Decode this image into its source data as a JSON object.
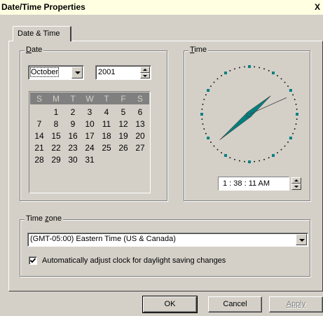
{
  "window": {
    "title": "Date/Time Properties",
    "close_glyph": "X"
  },
  "tabs": [
    {
      "label": "Date & Time"
    }
  ],
  "date_group": {
    "label_hotkey": "D",
    "label_rest": "ate",
    "month": "October",
    "year": "2001",
    "weekdays": [
      "S",
      "M",
      "T",
      "W",
      "T",
      "F",
      "S"
    ],
    "weeks": [
      [
        "",
        "1",
        "2",
        "3",
        "4",
        "5",
        "6"
      ],
      [
        "7",
        "8",
        "9",
        "10",
        "11",
        "12",
        "13"
      ],
      [
        "14",
        "15",
        "16",
        "17",
        "18",
        "19",
        "20"
      ],
      [
        "21",
        "22",
        "23",
        "24",
        "25",
        "26",
        "27"
      ],
      [
        "28",
        "29",
        "30",
        "31",
        "",
        "",
        ""
      ]
    ]
  },
  "time_group": {
    "label_hotkey": "T",
    "label_rest": "ime",
    "time_value": "1 : 38 : 11 AM",
    "clock": {
      "hour": 1,
      "minute": 38,
      "second": 11,
      "accent": "#008080"
    }
  },
  "timezone_group": {
    "label_prefix": "Time ",
    "label_hotkey": "z",
    "label_rest": "one",
    "selected": "(GMT-05:00) Eastern Time (US & Canada)"
  },
  "dst_checkbox": {
    "checked": true,
    "label": "Automatically adjust clock for daylight saving changes"
  },
  "buttons": {
    "ok": "OK",
    "cancel": "Cancel",
    "apply": "Apply"
  }
}
